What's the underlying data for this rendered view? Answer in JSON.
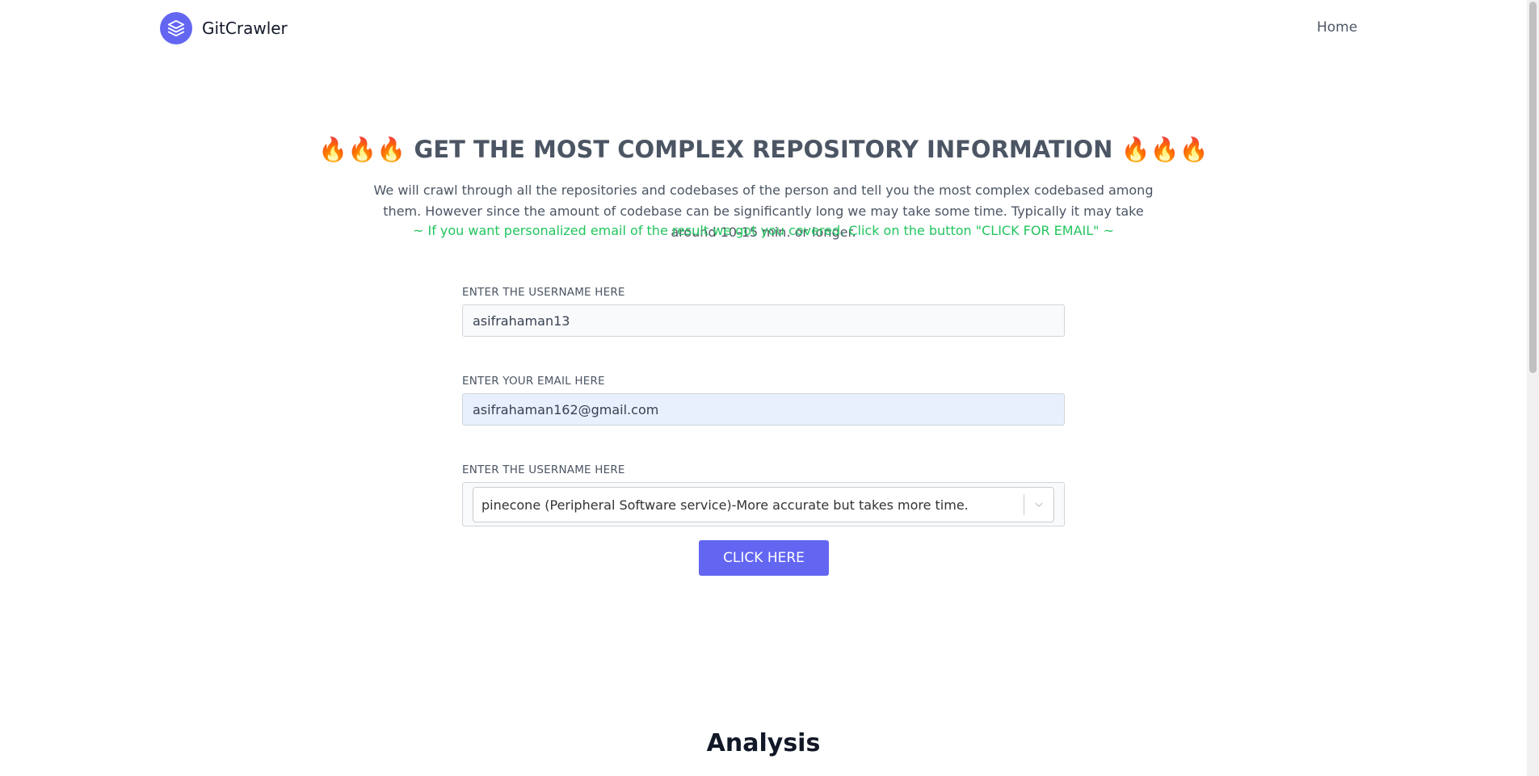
{
  "header": {
    "brand_name": "GitCrawler",
    "nav_home": "Home"
  },
  "hero": {
    "title": "🔥🔥🔥 GET THE MOST COMPLEX REPOSITORY INFORMATION 🔥🔥🔥",
    "description": "We will crawl through all the repositories and codebases of the person and tell you the most complex codebased among them. However since the amount of codebase can be significantly long we may take some time. Typically it may take around 10-15 min. or longer.",
    "note": "~ If you want personalized email of the result we got you covered. Click on the button \"CLICK FOR EMAIL\" ~"
  },
  "form": {
    "username_label": "ENTER THE USERNAME HERE",
    "username_value": "asifrahaman13",
    "email_label": "ENTER YOUR EMAIL HERE",
    "email_value": "asifrahaman162@gmail.com",
    "select_label": "ENTER THE USERNAME HERE",
    "select_value": "pinecone (Peripheral Software service)-More accurate but takes more time.",
    "submit_label": "CLICK HERE"
  },
  "analysis": {
    "title": "Analysis"
  },
  "colors": {
    "accent": "#6366f1",
    "note_green": "#22c55e",
    "email_autofill_bg": "#e8f0fe"
  },
  "icons": {
    "logo": "layers-icon",
    "select": "chevron-down-icon"
  }
}
